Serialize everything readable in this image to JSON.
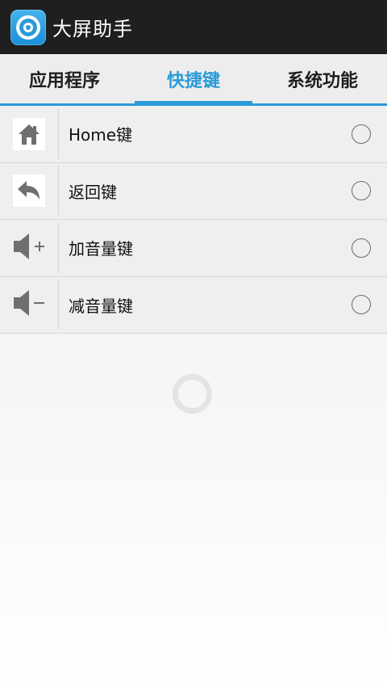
{
  "app": {
    "title": "大屏助手",
    "icon": "app-logo-icon"
  },
  "tabs": [
    {
      "label": "应用程序",
      "active": false
    },
    {
      "label": "快捷键",
      "active": true
    },
    {
      "label": "系统功能",
      "active": false
    }
  ],
  "shortcuts": [
    {
      "label": "Home键",
      "icon": "home-icon",
      "selected": false
    },
    {
      "label": "返回键",
      "icon": "back-arrow-icon",
      "selected": false
    },
    {
      "label": "加音量键",
      "icon": "volume-up-icon",
      "selected": false
    },
    {
      "label": "减音量键",
      "icon": "volume-down-icon",
      "selected": false
    }
  ],
  "colors": {
    "accent": "#2a9bd8",
    "titlebar": "#1f1f1f",
    "icon_gray": "#6f6f6f"
  }
}
